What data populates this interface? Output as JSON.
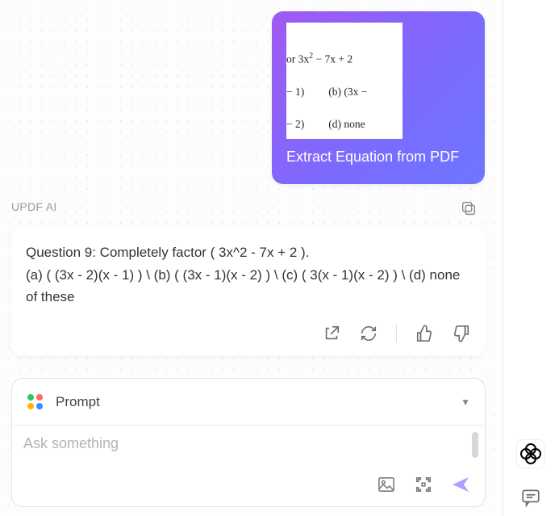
{
  "user_message": {
    "thumb": {
      "line1_prefix": "or 3x",
      "line1_exp": "2",
      "line1_suffix": " − 7x + 2",
      "line2_a": "− 1)",
      "line2_b": "(b)   (3x −",
      "line3_a": "− 2)",
      "line3_b": "(d)   none"
    },
    "caption": "Extract Equation from PDF"
  },
  "ai": {
    "label": "UPDF AI",
    "question": "Question 9: Completely factor ( 3x^2 - 7x + 2 ).",
    "options": "(a) ( (3x - 2)(x - 1) ) \\ (b) ( (3x - 1)(x - 2) ) \\ (c) ( 3(x - 1)(x - 2) ) \\ (d) none of these"
  },
  "prompt": {
    "header_label": "Prompt",
    "placeholder": "Ask something"
  },
  "icons": {
    "copy": "copy-icon",
    "external": "external-link-icon",
    "refresh": "refresh-icon",
    "thumbs_up": "thumbs-up-icon",
    "thumbs_down": "thumbs-down-icon",
    "image": "image-icon",
    "crop": "crop-icon",
    "send": "send-icon",
    "caret": "caret-down-icon",
    "logo": "updf-logo-icon",
    "comment": "comment-icon"
  }
}
